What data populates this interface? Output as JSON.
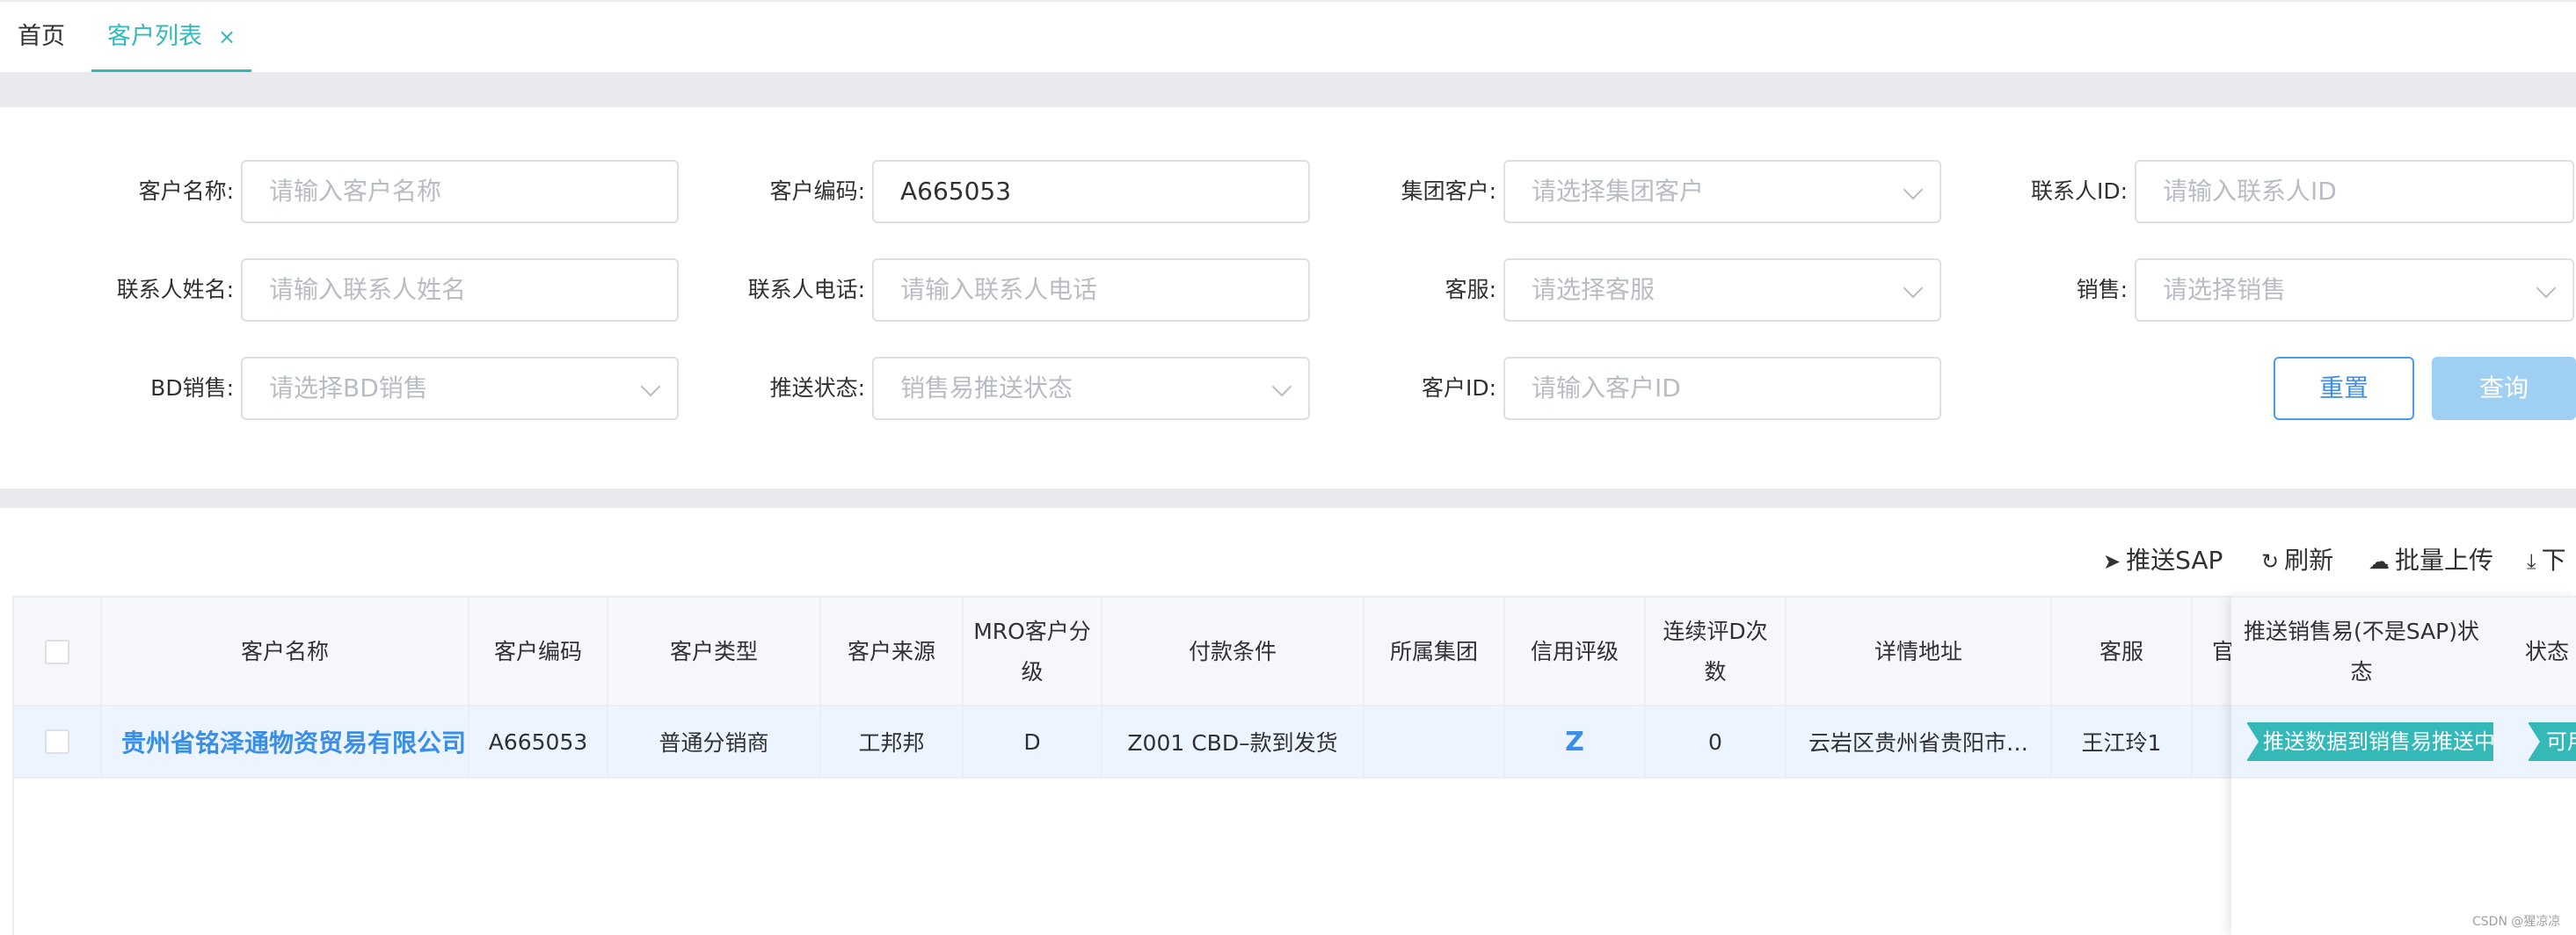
{
  "tabs": {
    "home": "首页",
    "active": "客户列表",
    "close": "×"
  },
  "filters": {
    "customer_name": {
      "label": "客户名称:",
      "placeholder": "请输入客户名称"
    },
    "customer_code": {
      "label": "客户编码:",
      "value": "A665053"
    },
    "group_customer": {
      "label": "集团客户:",
      "placeholder": "请选择集团客户"
    },
    "contact_id": {
      "label": "联系人ID:",
      "placeholder": "请输入联系人ID"
    },
    "contact_name": {
      "label": "联系人姓名:",
      "placeholder": "请输入联系人姓名"
    },
    "contact_phone": {
      "label": "联系人电话:",
      "placeholder": "请输入联系人电话"
    },
    "service": {
      "label": "客服:",
      "placeholder": "请选择客服"
    },
    "sales": {
      "label": "销售:",
      "placeholder": "请选择销售"
    },
    "bd_sales": {
      "label": "BD销售:",
      "placeholder": "请选择BD销售"
    },
    "push_status": {
      "label": "推送状态:",
      "placeholder": "销售易推送状态"
    },
    "customer_id": {
      "label": "客户ID:",
      "placeholder": "请输入客户ID"
    },
    "reset_label": "重置",
    "query_label": "查询"
  },
  "toolbar": {
    "push_sap": "推送SAP",
    "refresh": "刷新",
    "batch_upload": "批量上传",
    "download": "下"
  },
  "table": {
    "headers": {
      "name": "客户名称",
      "code": "客户编码",
      "type": "客户类型",
      "source": "客户来源",
      "mro": "MRO客户分级",
      "payment": "付款条件",
      "group": "所属集团",
      "credit": "信用评级",
      "consecutive": "连续评D次数",
      "address": "详情地址",
      "service": "客服",
      "official": "官",
      "push_status": "推送销售易(不是SAP)状态",
      "status": "状态"
    },
    "rows": [
      {
        "name": "贵州省铭泽通物资贸易有限公司",
        "code": "A665053",
        "type": "普通分销商",
        "source": "工邦邦",
        "mro": "D",
        "payment": "Z001 CBD–款到发货",
        "group": "",
        "credit": "Z",
        "consecutive": "0",
        "address": "云岩区贵州省贵阳市…",
        "service": "王江玲1",
        "push_tag": "推送数据到销售易推送中",
        "status_tag": "可用"
      }
    ]
  },
  "watermark": "CSDN @猩凉凉",
  "colors": {
    "accent": "#35b8b8",
    "primary": "#3a8ee6",
    "query_disabled": "#a0cff4"
  }
}
